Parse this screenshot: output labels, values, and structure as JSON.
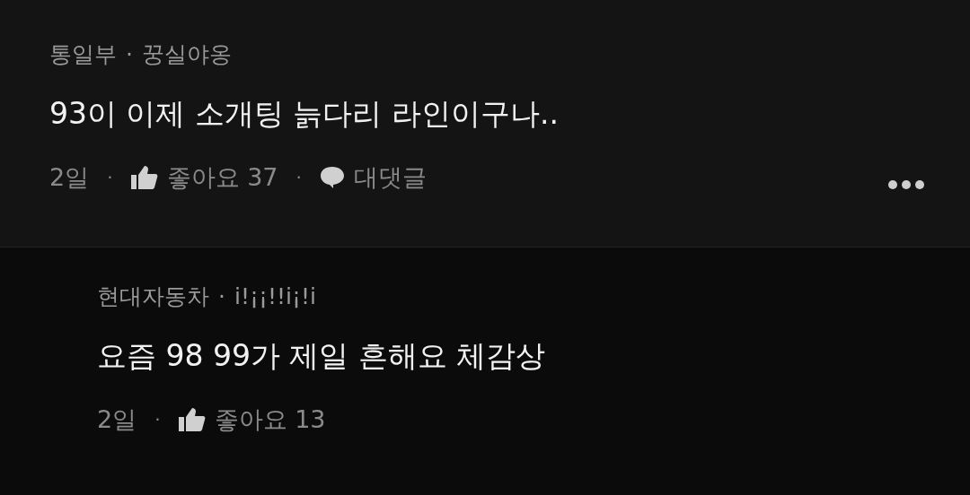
{
  "comments": [
    {
      "kind": "comment",
      "group": "통일부",
      "group_sep": "·",
      "author": "꿍실야옹",
      "text": "93이 이제 소개팅 늙다리 라인이구나..",
      "time": "2일",
      "time_sep": "·",
      "likes": "좋아요 37",
      "likes_sep": "·",
      "reply_label": "대댓글",
      "has_menu": true
    },
    {
      "kind": "reply",
      "group": "현대자동차",
      "group_sep": "·",
      "author": "i!¡¡!!i¡!i",
      "text": "요즘 98 99가 제일 흔해요 체감상",
      "time": "2일",
      "time_sep": "·",
      "likes": "좋아요 13",
      "has_menu": false
    }
  ]
}
